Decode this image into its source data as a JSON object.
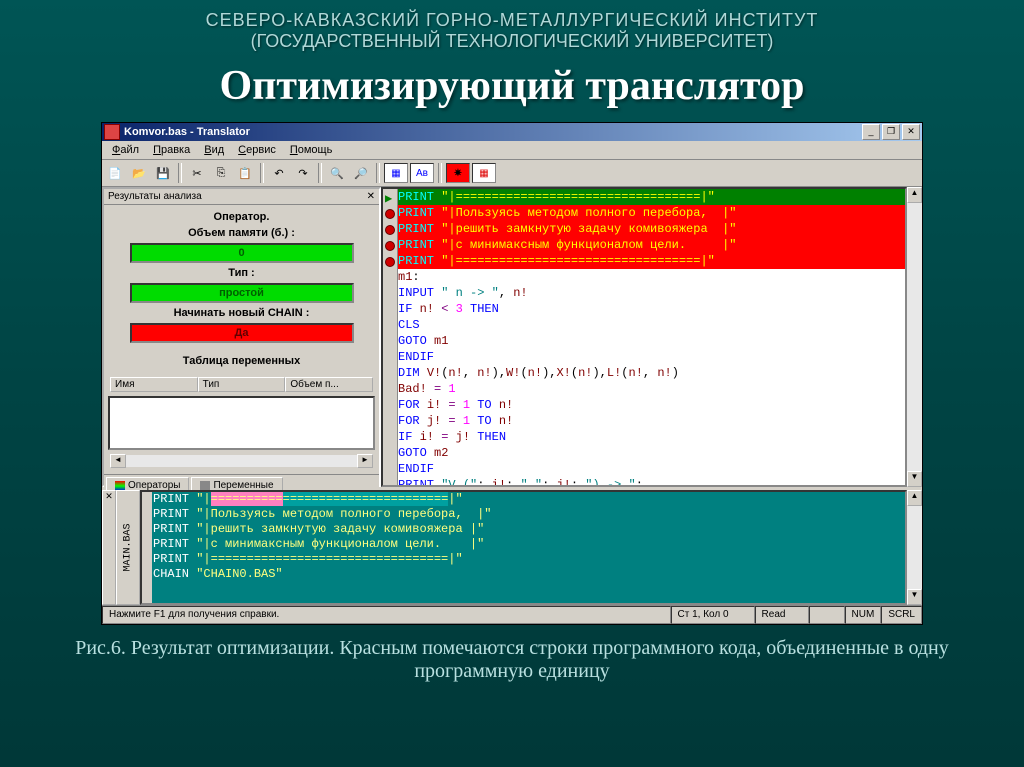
{
  "slide": {
    "uni1": "СЕВЕРО-КАВКАЗСКИЙ ГОРНО-МЕТАЛЛУРГИЧЕСКИЙ ИНСТИТУТ",
    "uni2": "(ГОСУДАРСТВЕННЫЙ ТЕХНОЛОГИЧЕСКИЙ УНИВЕРСИТЕТ)",
    "title": "Оптимизирующий транслятор",
    "caption": "Рис.6. Результат оптимизации. Красным помечаются строки программного кода, объединенные в одну программную единицу"
  },
  "window": {
    "title": "Komvor.bas - Translator",
    "menu": {
      "file": "Файл",
      "edit": "Правка",
      "view": "Вид",
      "service": "Сервис",
      "help": "Помощь"
    }
  },
  "panel": {
    "title": "Результаты анализа",
    "operator_label": "Оператор.",
    "memory_label": "Объем памяти (б.) :",
    "memory_value": "0",
    "type_label": "Тип :",
    "type_value": "простой",
    "chain_label": "Начинать новый CHAIN :",
    "chain_value": "Да",
    "vartable_label": "Таблица переменных",
    "columns": {
      "name": "Имя",
      "type": "Тип",
      "mem": "Объем п..."
    },
    "tabs": {
      "operators": "Операторы",
      "vars": "Переменные"
    }
  },
  "code": [
    {
      "cls": "line-green",
      "gut": "arrow",
      "html": "<span class='kw'>PRINT</span> <span class='str'>\"|==================================|\"</span>"
    },
    {
      "cls": "line-red",
      "gut": "dot",
      "html": "<span class='kw'>PRINT</span> <span class='str'>\"|Пользуясь методом полного перебора,  |\"</span>"
    },
    {
      "cls": "line-red",
      "gut": "dot",
      "html": "<span class='kw'>PRINT</span> <span class='str'>\"|решить замкнутую задачу комивояжера  |\"</span>"
    },
    {
      "cls": "line-red",
      "gut": "dot",
      "html": "<span class='kw'>PRINT</span> <span class='str'>\"|с минимаксным функционалом цели.     |\"</span>"
    },
    {
      "cls": "line-red",
      "gut": "dot",
      "html": "<span class='kw'>PRINT</span> <span class='str'>\"|==================================|\"</span>"
    },
    {
      "cls": "",
      "html": "<span class='var'>m1</span>:"
    },
    {
      "cls": "",
      "html": "<span class='kw'>INPUT</span> <span class='str'>\" n -> \"</span>, <span class='var'>n!</span>"
    },
    {
      "cls": "",
      "html": "<span class='kw'>IF</span> <span class='var'>n!</span> <span class='op'><</span> <span class='num'>3</span> <span class='kw'>THEN</span>"
    },
    {
      "cls": "",
      "html": "<span class='kw'>CLS</span>"
    },
    {
      "cls": "",
      "html": "<span class='kw'>GOTO</span> <span class='var'>m1</span>"
    },
    {
      "cls": "",
      "html": "<span class='kw'>ENDIF</span>"
    },
    {
      "cls": "",
      "html": "<span class='kw'>DIM</span> <span class='var'>V!</span>(<span class='var'>n!</span>, <span class='var'>n!</span>),<span class='var'>W!</span>(<span class='var'>n!</span>),<span class='var'>X!</span>(<span class='var'>n!</span>),<span class='var'>L!</span>(<span class='var'>n!</span>, <span class='var'>n!</span>)"
    },
    {
      "cls": "",
      "html": "<span class='var'>Bad!</span> <span class='op'>=</span> <span class='num'>1</span>"
    },
    {
      "cls": "",
      "html": "<span class='kw'>FOR</span> <span class='var'>i!</span> <span class='op'>=</span> <span class='num'>1</span> <span class='kw'>TO</span> <span class='var'>n!</span>"
    },
    {
      "cls": "",
      "html": "<span class='kw'>FOR</span> <span class='var'>j!</span> <span class='op'>=</span> <span class='num'>1</span> <span class='kw'>TO</span> <span class='var'>n!</span>"
    },
    {
      "cls": "",
      "html": "<span class='kw'>IF</span> <span class='var'>i!</span> <span class='op'>=</span> <span class='var'>j!</span> <span class='kw'>THEN</span>"
    },
    {
      "cls": "",
      "html": "<span class='kw'>GOTO</span> <span class='var'>m2</span>"
    },
    {
      "cls": "",
      "html": "<span class='kw'>ENDIF</span>"
    },
    {
      "cls": "",
      "html": "<span class='kw'>PRINT</span> <span class='str'>\"V (\"</span>; <span class='var'>i!</span>; <span class='str'>\",\"</span>; <span class='var'>j!</span>; <span class='str'>\") -> \"</span>;"
    }
  ],
  "bottom": {
    "side_label": "MAIN.BAS",
    "lines": [
      "<span class='bp-kw'>PRINT</span> <span class='bp-str'>\"|<span class='bp-hilite-pink'>==========</span><span class='bp-hilite-teal'>=======================</span>|\"</span>",
      "<span class='bp-kw'>PRINT</span> <span class='bp-str'>\"|Пользуясь методом полного перебора,  |\"</span>",
      "<span class='bp-kw'>PRINT</span> <span class='bp-str'>\"|решить замкнутую задачу комивояжера |\"</span>",
      "<span class='bp-kw'>PRINT</span> <span class='bp-str'>\"|с минимаксным функционалом цели.    |\"</span>",
      "<span class='bp-kw'>PRINT</span> <span class='bp-str'>\"|=================================|\"</span>",
      "<span class='bp-kw'>CHAIN</span> <span class='bp-str'>\"CHAIN0.BAS\"</span>"
    ]
  },
  "status": {
    "hint": "Нажмите F1 для получения справки.",
    "pos": "Ст 1, Кол 0",
    "mode": "Read",
    "num": "NUM",
    "scrl": "SCRL"
  }
}
